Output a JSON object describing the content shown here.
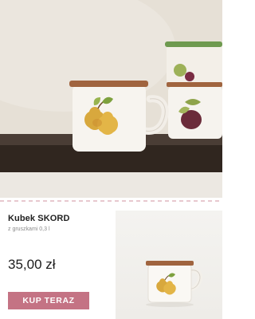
{
  "product": {
    "name": "Kubek SKORD",
    "description": "z gruszkami 0,3 l",
    "price": "35,00 zł"
  },
  "actions": {
    "buy_label": "KUP TERAZ"
  },
  "colors": {
    "accent": "#c47384",
    "divider": "#e8c8cf",
    "lid_brown": "#a0643f",
    "shelf": "#3a2f29"
  },
  "icons": {
    "hero": "mug-photo",
    "thumb": "mug-thumbnail"
  }
}
